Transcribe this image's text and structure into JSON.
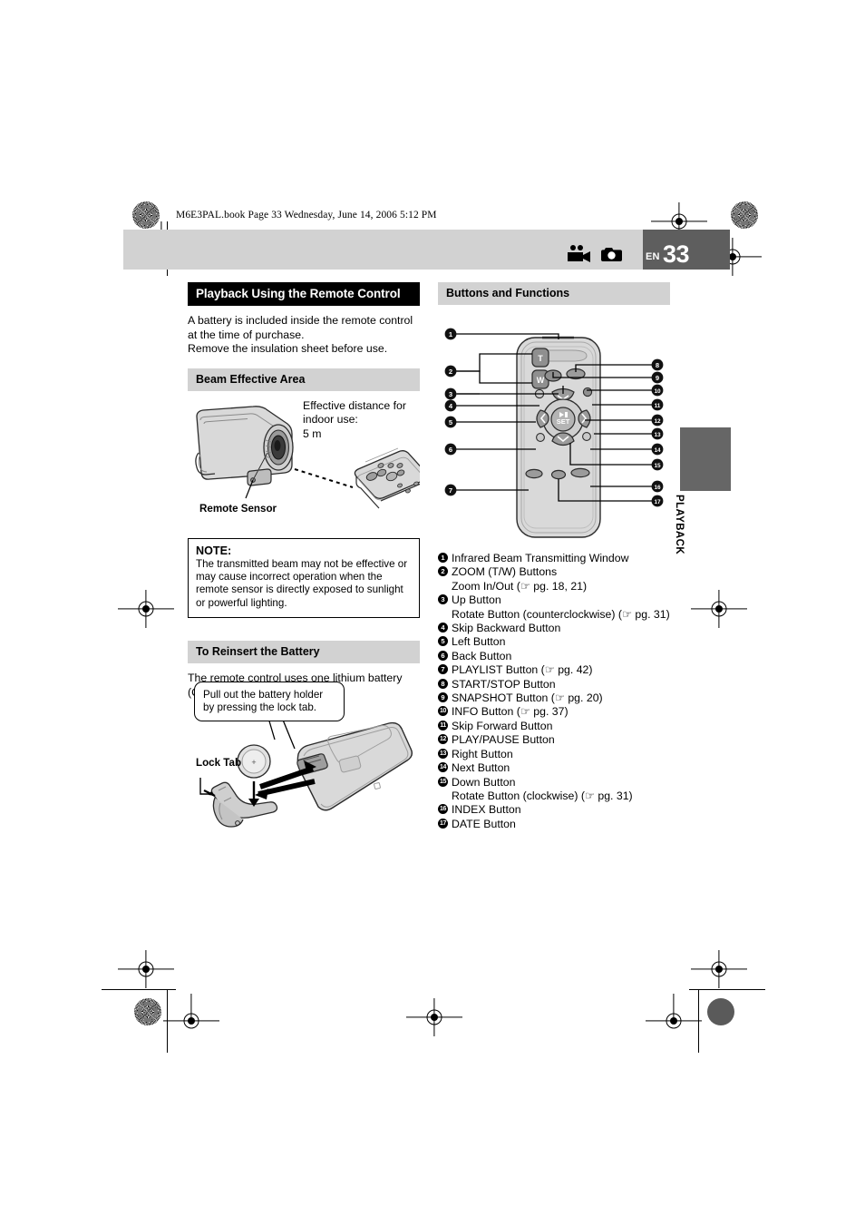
{
  "header": {
    "book_line": "M6E3PAL.book  Page 33  Wednesday, June 14, 2006  5:12 PM",
    "lang": "EN",
    "page_number": "33",
    "icons": [
      "camcorder-icon",
      "camera-icon"
    ]
  },
  "side_tab": {
    "label": "PLAYBACK"
  },
  "left": {
    "title": "Playback Using the Remote Control",
    "intro": "A battery is included inside the remote control at the time of purchase.\nRemove the insulation sheet before use.",
    "section_beam": "Beam Effective Area",
    "beam_fig": {
      "effective_text": "Effective distance for\nindoor use:\n5 m",
      "sensor_label": "Remote Sensor"
    },
    "note": {
      "title": "NOTE:",
      "body": "The transmitted beam may not be effective or may cause incorrect operation when the remote sensor is directly exposed to sunlight or powerful lighting."
    },
    "section_battery": "To Reinsert the Battery",
    "battery_text": "The remote control uses one lithium battery (CR2025).",
    "battery_fig": {
      "callout": "Pull out the battery holder by pressing the lock tab.",
      "lock_tab_label": "Lock Tab"
    }
  },
  "right": {
    "section_buttons": "Buttons and Functions",
    "remote_keys": {
      "zoom_t": "T",
      "zoom_w": "W",
      "set": "SET"
    },
    "functions": [
      {
        "n": "1",
        "label": "Infrared Beam Transmitting Window",
        "sub": ""
      },
      {
        "n": "2",
        "label": "ZOOM (T/W) Buttons",
        "sub": "Zoom In/Out (☞ pg. 18, 21)"
      },
      {
        "n": "3",
        "label": "Up Button",
        "sub": "Rotate Button (counterclockwise) (☞ pg. 31)"
      },
      {
        "n": "4",
        "label": "Skip Backward Button",
        "sub": ""
      },
      {
        "n": "5",
        "label": "Left Button",
        "sub": ""
      },
      {
        "n": "6",
        "label": "Back Button",
        "sub": ""
      },
      {
        "n": "7",
        "label": "PLAYLIST Button (☞ pg. 42)",
        "sub": ""
      },
      {
        "n": "8",
        "label": "START/STOP Button",
        "sub": ""
      },
      {
        "n": "9",
        "label": "SNAPSHOT Button (☞ pg. 20)",
        "sub": ""
      },
      {
        "n": "10",
        "label": "INFO Button (☞ pg. 37)",
        "sub": ""
      },
      {
        "n": "11",
        "label": "Skip Forward Button",
        "sub": ""
      },
      {
        "n": "12",
        "label": "PLAY/PAUSE Button",
        "sub": ""
      },
      {
        "n": "13",
        "label": "Right Button",
        "sub": ""
      },
      {
        "n": "14",
        "label": "Next Button",
        "sub": ""
      },
      {
        "n": "15",
        "label": "Down Button",
        "sub": "Rotate Button (clockwise) (☞ pg. 31)"
      },
      {
        "n": "16",
        "label": "INDEX Button",
        "sub": ""
      },
      {
        "n": "17",
        "label": "DATE Button",
        "sub": ""
      }
    ]
  },
  "colors": {
    "header_band": "#d2d2d2",
    "header_page_block": "#5e5e5e",
    "side_tab": "#666666",
    "title_bar": "#000000",
    "illustration_fill": "#d7d7d7"
  }
}
